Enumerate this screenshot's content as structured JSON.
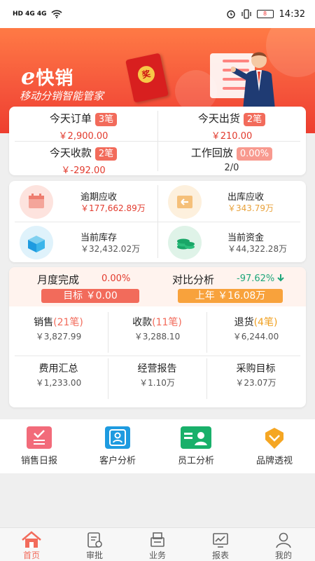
{
  "status_bar": {
    "left": "HD 4G 4G",
    "battery": "8",
    "time": "14:32"
  },
  "brand": {
    "logo_e": "e",
    "logo_text": "快销",
    "slogan": "移动分销智能管家",
    "packet_char": "奖"
  },
  "daily": [
    {
      "label": "今天订单",
      "tag": "3笔",
      "value": "￥2,900.00"
    },
    {
      "label": "今天出货",
      "tag": "2笔",
      "value": "￥210.00"
    },
    {
      "label": "今天收款",
      "tag": "2笔",
      "value": "￥-292.00"
    },
    {
      "label": "工作回放",
      "tag": "0.00%",
      "value": "2/0"
    }
  ],
  "finance": [
    {
      "label": "逾期应收",
      "value": "￥177,662.89万",
      "icon": "calendar-icon"
    },
    {
      "label": "出库应收",
      "value": "￥343.79万",
      "icon": "outbound-icon"
    },
    {
      "label": "当前库存",
      "value": "￥32,432.02万",
      "icon": "inventory-box-icon"
    },
    {
      "label": "当前资金",
      "value": "￥44,322.28万",
      "icon": "money-stack-icon"
    }
  ],
  "monthly": {
    "title": "月度完成",
    "percent": "0.00%",
    "target": "目标 ￥0.00",
    "compare_title": "对比分析",
    "compare_percent": "-97.62%",
    "last_year": "上年 ￥16.08万"
  },
  "stats": [
    {
      "label": "销售",
      "count": "(21笔)",
      "value": "￥3,827.99"
    },
    {
      "label": "收款",
      "count": "(11笔)",
      "value": "￥3,288.10"
    },
    {
      "label": "退货",
      "count": "(4笔)",
      "value": "￥6,244.00"
    },
    {
      "label": "费用汇总",
      "count": "",
      "value": "￥1,233.00"
    },
    {
      "label": "经营报告",
      "count": "",
      "value": "￥1.10万"
    },
    {
      "label": "采购目标",
      "count": "",
      "value": "￥23.07万"
    }
  ],
  "quick_links": [
    {
      "label": "销售日报",
      "icon": "sales-report-icon",
      "color": "#f26b7a"
    },
    {
      "label": "客户分析",
      "icon": "customer-analysis-icon",
      "color": "#1e9be0"
    },
    {
      "label": "员工分析",
      "icon": "employee-analysis-icon",
      "color": "#19b06a"
    },
    {
      "label": "品牌透视",
      "icon": "brand-badge-icon",
      "color": "#f5a623"
    }
  ],
  "tabs": [
    {
      "label": "首页",
      "icon": "home-icon",
      "active": true
    },
    {
      "label": "审批",
      "icon": "approval-icon",
      "active": false
    },
    {
      "label": "业务",
      "icon": "business-icon",
      "active": false
    },
    {
      "label": "报表",
      "icon": "report-icon",
      "active": false
    },
    {
      "label": "我的",
      "icon": "profile-icon",
      "active": false
    }
  ]
}
